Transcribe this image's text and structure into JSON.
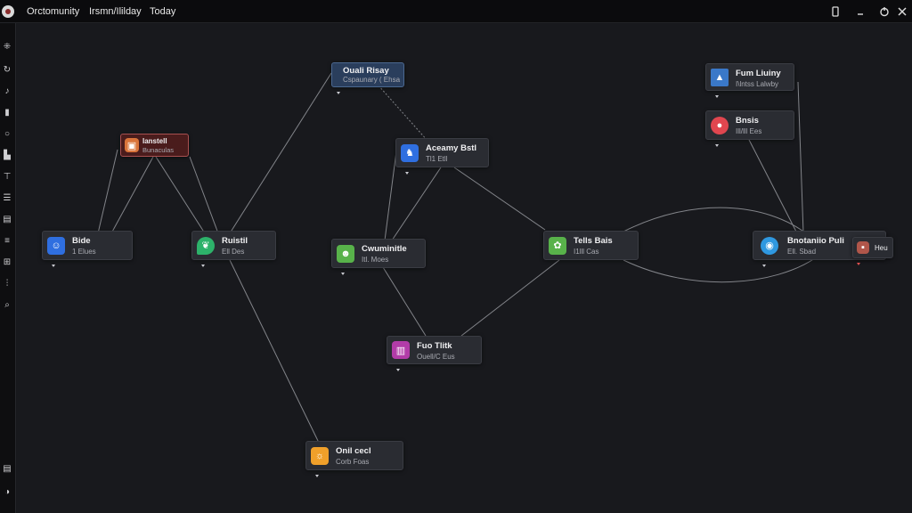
{
  "titlebar": {
    "menu": [
      "Orctomunity",
      "Irsmn/Ililday",
      "Today"
    ]
  },
  "window_controls": [
    "restore-icon",
    "minimize-icon",
    "power-icon",
    "close-icon"
  ],
  "sidebar_icons": [
    "graph-icon",
    "refresh-icon",
    "music-icon",
    "chart-icon",
    "circle-icon",
    "document-icon",
    "tag-icon",
    "list-icon",
    "bar-icon",
    "menu-icon",
    "grid-icon",
    "filter-icon",
    "search-icon",
    "layers-icon",
    "info-icon"
  ],
  "nodes": [
    {
      "id": "n1",
      "title": "Ouali Risay",
      "subtitle": "Cspaunary ( Ehsa",
      "icon": "photo-icon",
      "color": "#4d6c9a"
    },
    {
      "id": "n2",
      "title": "Ianstell",
      "subtitle": "Bunaculas",
      "icon": "photo-icon",
      "color": "#d9743a"
    },
    {
      "id": "n3",
      "title": "Aceamy Bstl",
      "subtitle": "Tl1 Etll",
      "icon": "tooth-icon",
      "color": "#2f6fe0"
    },
    {
      "id": "n4",
      "title": "Bide",
      "subtitle": "1 Elues",
      "icon": "person-icon",
      "color": "#2f6fe0"
    },
    {
      "id": "n5",
      "title": "Ruistil",
      "subtitle": "Ell Des",
      "icon": "leaf-icon",
      "color": "#2db26a"
    },
    {
      "id": "n6",
      "title": "Cwuminitle",
      "subtitle": "Itl. Moes",
      "icon": "smile-icon",
      "color": "#58b24a"
    },
    {
      "id": "n7",
      "title": "Tells Bais",
      "subtitle": "I1lll Cas",
      "icon": "plant-icon",
      "color": "#58b24a"
    },
    {
      "id": "n8",
      "title": "Fum Liuiny",
      "subtitle": "I\\lntss Lalwby",
      "icon": "photo-icon",
      "color": "#3a78c8"
    },
    {
      "id": "n9",
      "title": "Bnsis",
      "subtitle": "Ill/lll Ees",
      "icon": "drop-icon",
      "color": "#e0464f"
    },
    {
      "id": "n10",
      "title": "Bnotaniio Puli",
      "subtitle": "Ell. Sbad",
      "icon": "globe-icon",
      "color": "#2f98e0"
    },
    {
      "id": "n11",
      "title": "Heu",
      "subtitle": "",
      "icon": "photo-icon",
      "color": "#b0564a"
    },
    {
      "id": "n12",
      "title": "Fuo Tlitk",
      "subtitle": "Ouell/C Eus",
      "icon": "book-icon",
      "color": "#b23ca8"
    },
    {
      "id": "n13",
      "title": "Onil cecl",
      "subtitle": "Corb Foas",
      "icon": "bulb-icon",
      "color": "#f0a02a"
    }
  ]
}
